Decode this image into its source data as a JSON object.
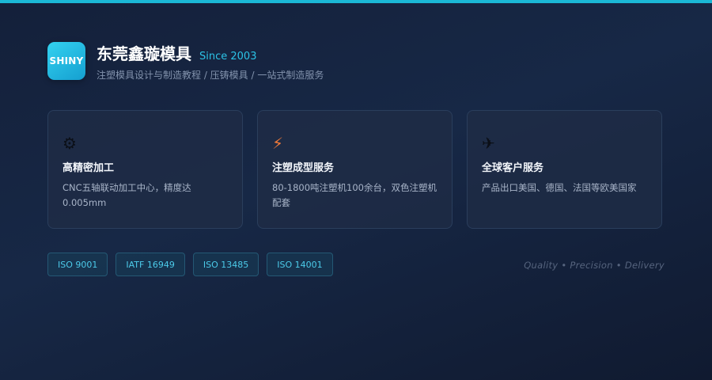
{
  "colors": {
    "accent": "#1bb8d6",
    "background": "#14203a",
    "card": "#1e2c46",
    "badge_text": "#4ccbea"
  },
  "brand": {
    "logo_text": "SHINY",
    "name": "东莞鑫璇模具",
    "since": "Since 2003",
    "tagline": "注塑模具设计与制造教程 / 压铸模具 / 一站式制造服务"
  },
  "cards": [
    {
      "icon": "gear-icon",
      "icon_glyph": "⚙",
      "title": "高精密加工",
      "desc": "CNC五轴联动加工中心，精度达0.005mm"
    },
    {
      "icon": "lightning-icon",
      "icon_glyph": "⚡",
      "title": "注塑成型服务",
      "desc": "80-1800吨注塑机100余台，双色注塑机配套"
    },
    {
      "icon": "airplane-icon",
      "icon_glyph": "✈",
      "title": "全球客户服务",
      "desc": "产品出口美国、德国、法国等欧美国家"
    }
  ],
  "badges": [
    "ISO 9001",
    "IATF 16949",
    "ISO 13485",
    "ISO 14001"
  ],
  "motto": "Quality • Precision • Delivery"
}
